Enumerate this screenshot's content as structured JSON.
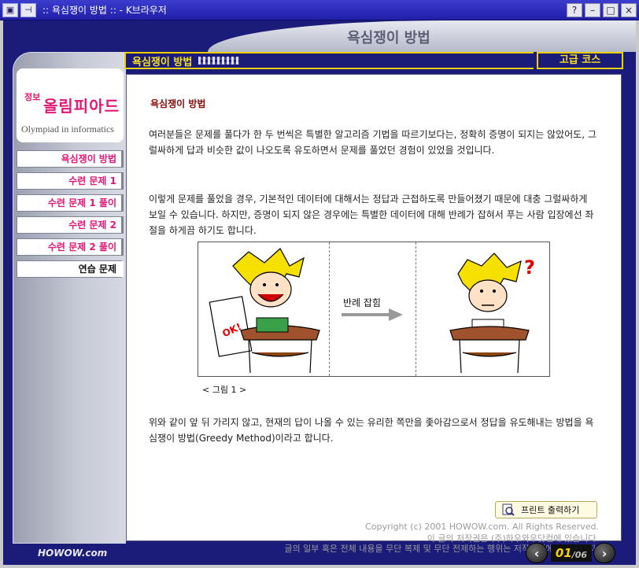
{
  "window": {
    "title": ":: 욕심쟁이 방법 :: - K브라우저",
    "icon1": "app-icon",
    "icon2": "pin-icon",
    "help_label": "?",
    "minimize_label": "–",
    "maximize_label": "□",
    "close_label": "×"
  },
  "app": {
    "title": "욕심쟁이 방법"
  },
  "logo": {
    "small": "정보",
    "main": "올림피아드",
    "sub": "Olympiad in informatics"
  },
  "sidebar": {
    "items": [
      {
        "label": "욕심쟁이 방법",
        "active": false
      },
      {
        "label": "수련 문제 1",
        "active": false
      },
      {
        "label": "수련 문제 1 풀이",
        "active": false
      },
      {
        "label": "수련 문제 2",
        "active": false
      },
      {
        "label": "수련 문제 2 풀이",
        "active": false
      },
      {
        "label": "연습 문제",
        "active": true
      }
    ]
  },
  "header": {
    "section_title": "욕심쟁이 방법",
    "level": "고급 코스"
  },
  "content": {
    "heading": "욕심쟁이 방법",
    "paragraph1": "여러분들은 문제를 풀다가 한 두 번씩은 특별한 알고리즘 기법을 따르기보다는, 정확히 증명이 되지는 않았어도, 그럴싸하게 답과 비슷한 값이 나오도록 유도하면서 문제를 풀었던 경험이 있었을 것입니다.",
    "paragraph2": "이렇게 문제를 풀었을 경우, 기본적인 데이터에 대해서는 정답과 근접하도록 만들어졌기 때문에 대충 그럴싸하게 보일 수 있습니다. 하지만, 증명이 되지 않은 경우에는 특별한 데이터에 대해 반례가 잡혀서 푸는 사람 입장에선 좌절을 하게끔 하기도 합니다.",
    "figure_text": "반례 잡힘",
    "figure_ok_label": "OK!",
    "figure_question_label": "?",
    "caption": "< 그림 1 >",
    "paragraph3": "위와 같이 앞 뒤 가리지 않고, 현재의 답이 나올 수 있는 유리한 쪽만을 좇아감으로서 정답을 유도해내는 방법을 욕심쟁이 방법(Greedy Method)이라고 합니다."
  },
  "print_button": {
    "label": "프린트 출력하기",
    "icon": "print-preview-icon"
  },
  "copyright": [
    "Copyright (c) 2001 HOWOW.com. All Rights Reserved.",
    "이 글의 저작권은 (주)하우와우닷컴에 있습니다.",
    "글의 일부 혹은 전체 내용을 무단 복제 및 무단 전제하는 행위는 저작권법에 저촉됩니다."
  ],
  "footer": {
    "brand": "HOWOW.com",
    "page_current": "01",
    "page_total": "/06",
    "prev_icon": "chevron-left-icon",
    "next_icon": "chevron-right-icon"
  },
  "colors": {
    "frame": "#1b1b7a",
    "accent_yellow": "#f6e020",
    "nav_pink": "#e31774",
    "heading_red": "#8b0a0a"
  }
}
